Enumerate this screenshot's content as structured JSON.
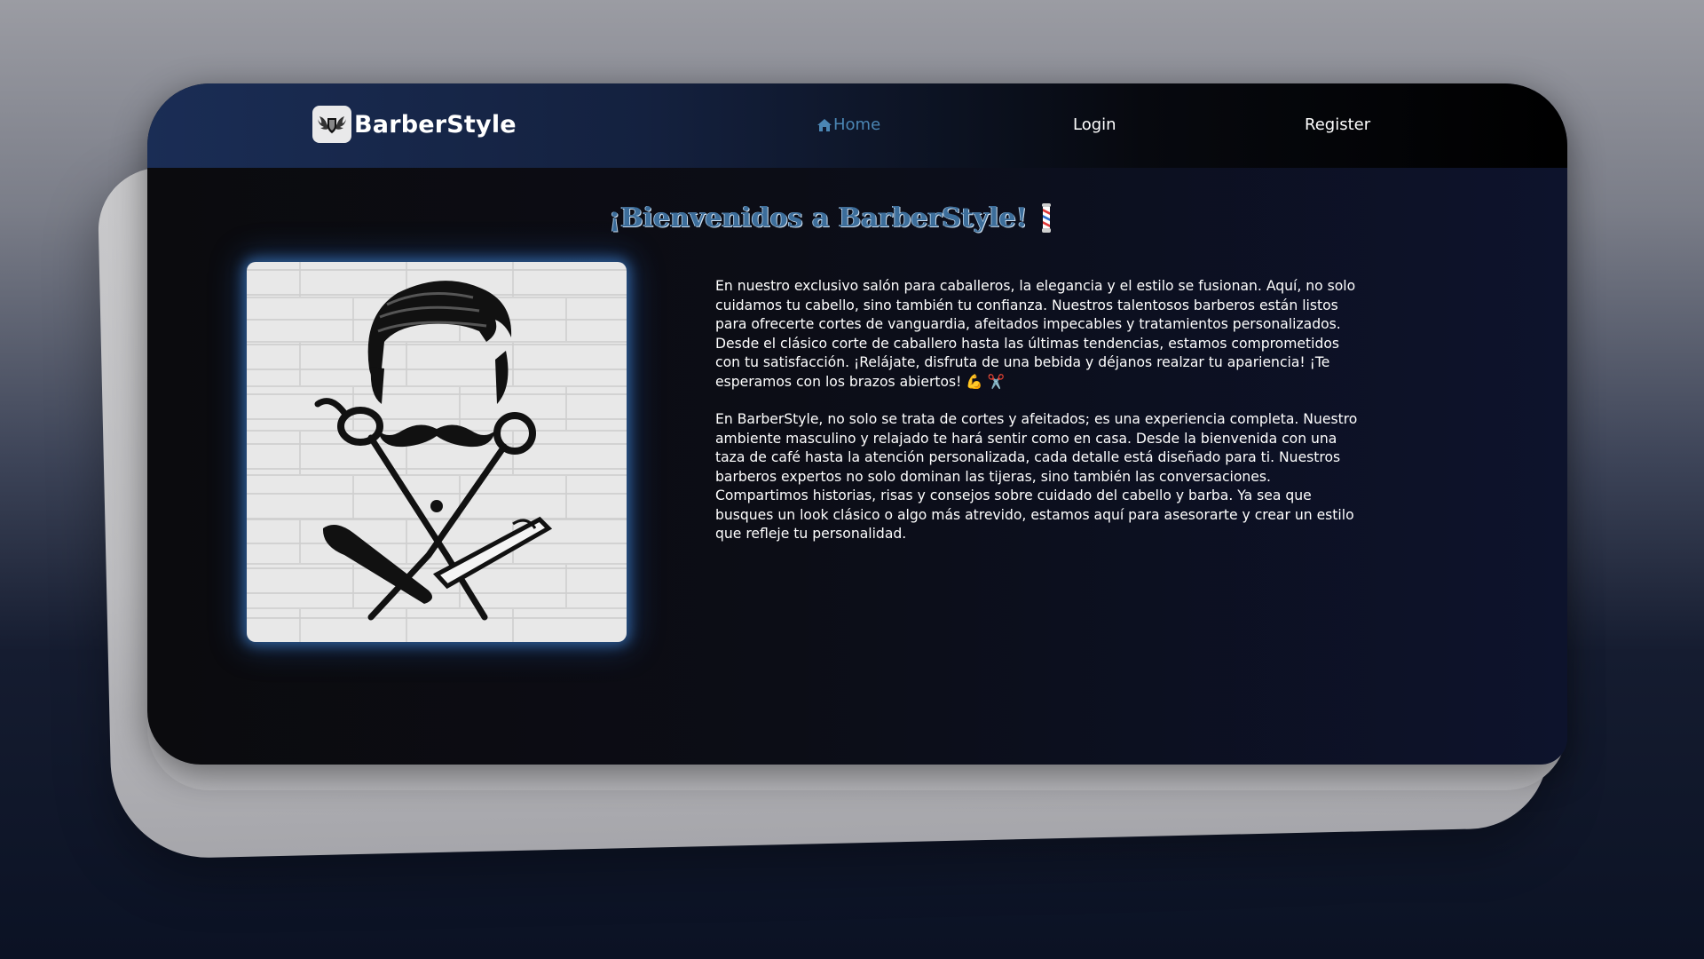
{
  "brand": {
    "name": "BarberStyle",
    "logo_icon": "winged-shield-logo"
  },
  "nav": {
    "home_label": "Home",
    "home_icon": "home-icon",
    "login_label": "Login",
    "register_label": "Register",
    "active": "Home"
  },
  "main": {
    "title": "¡Bienvenidos a BarberStyle!",
    "title_icon": "barber-pole-icon",
    "image_alt": "barber-logo-illustration",
    "paragraph_1": "En nuestro exclusivo salón para caballeros, la elegancia y el estilo se fusionan. Aquí, no solo cuidamos tu cabello, sino también tu confianza. Nuestros talentosos barberos están listos para ofrecerte cortes de vanguardia, afeitados impecables y tratamientos personalizados. Desde el clásico corte de caballero hasta las últimas tendencias, estamos comprometidos con tu satisfacción. ¡Relájate, disfruta de una bebida y déjanos realzar tu apariencia! ¡Te esperamos con los brazos abiertos!",
    "paragraph_1_emoji_1": "💪",
    "paragraph_1_emoji_2": "✂️",
    "paragraph_2": "En BarberStyle, no solo se trata de cortes y afeitados; es una experiencia completa. Nuestro ambiente masculino y relajado te hará sentir como en casa. Desde la bienvenida con una taza de café hasta la atención personalizada, cada detalle está diseñado para ti. Nuestros barberos expertos no solo dominan las tijeras, sino también las conversaciones. Compartimos historias, risas y consejos sobre cuidado del cabello y barba. Ya sea que busques un look clásico o algo más atrevido, estamos aquí para asesorarte y crear un estilo que refleje tu personalidad."
  },
  "colors": {
    "accent": "#4b86b4",
    "title": "#3c6d9a",
    "text": "#ffffff",
    "background": "#0c0d16"
  }
}
